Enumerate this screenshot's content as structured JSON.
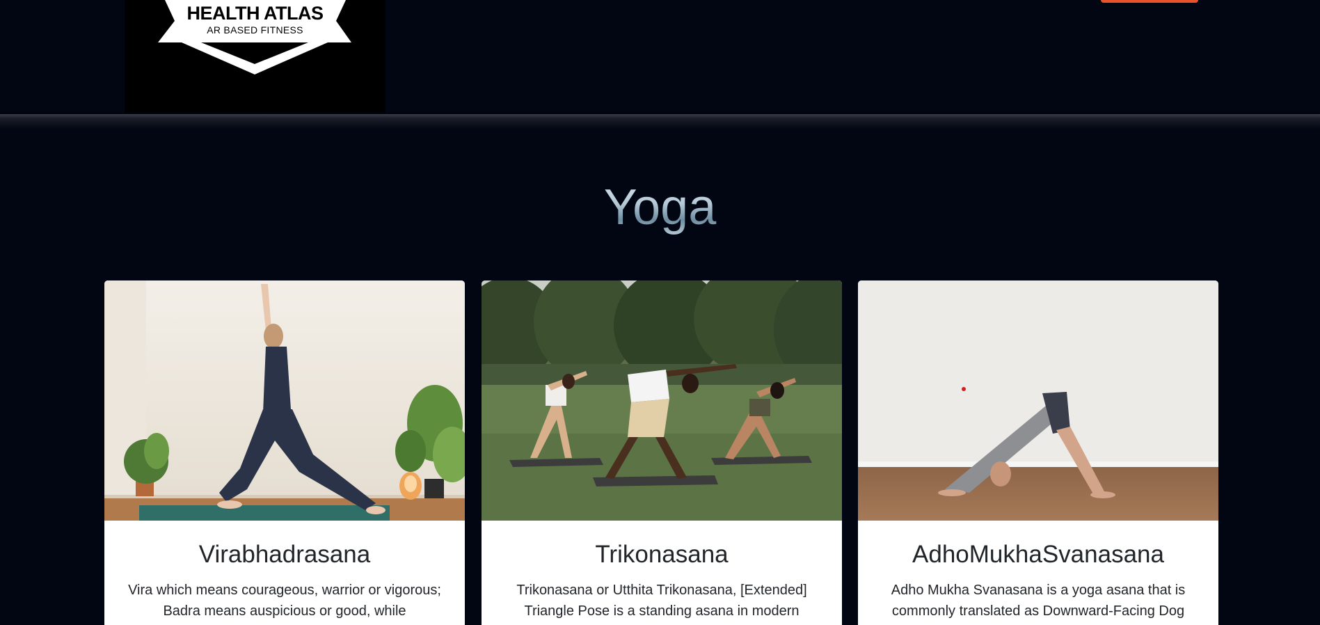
{
  "brand": {
    "title": "HEALTH ATLAS",
    "subtitle": "AR BASED FITNESS"
  },
  "section": {
    "title": "Yoga"
  },
  "cards": [
    {
      "title": "Virabhadrasana",
      "text": "Vira which means courageous, warrior or vigorous; Badra means auspicious or good, while",
      "image": "warrior-pose-photo"
    },
    {
      "title": "Trikonasana",
      "text": "Trikonasana or Utthita Trikonasana, [Extended] Triangle Pose is a standing asana in modern",
      "image": "triangle-pose-group-photo"
    },
    {
      "title": "AdhoMukhaSvanasana",
      "text": "Adho Mukha Svanasana is a yoga asana that is commonly translated as Downward-Facing Dog",
      "image": "downward-dog-photo"
    }
  ],
  "colors": {
    "background": "#020612",
    "accent": "#e8512c",
    "card": "#ffffff",
    "text": "#212529"
  }
}
